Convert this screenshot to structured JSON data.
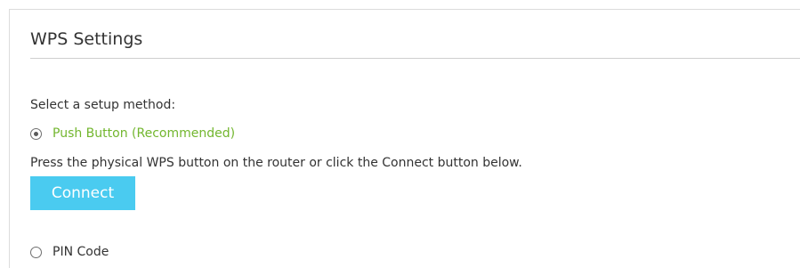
{
  "section": {
    "title": "WPS Settings"
  },
  "setup": {
    "prompt": "Select a setup method:",
    "options": [
      {
        "label": "Push Button (Recommended)",
        "selected": true
      },
      {
        "label": "PIN Code",
        "selected": false
      }
    ],
    "instruction": "Press the physical WPS button on the router or click the Connect button below.",
    "connect_label": "Connect"
  },
  "colors": {
    "accent_green": "#72b62e",
    "button_blue": "#4acbf0",
    "text": "#333333",
    "rule": "#cfcfcf"
  },
  "icons": {
    "selected_radio": "radio-checked-icon",
    "unselected_radio": "radio-unchecked-icon"
  }
}
